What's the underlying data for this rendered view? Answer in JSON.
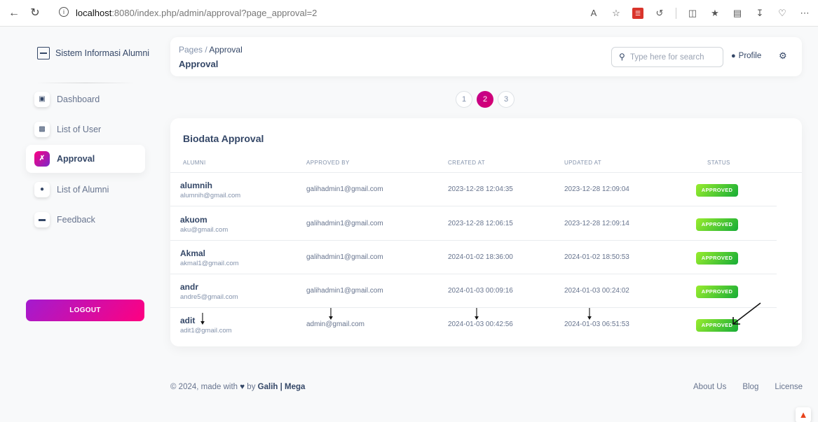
{
  "browser": {
    "url_host": "localhost",
    "url_path": ":8080/index.php/admin/approval?page_approval=2",
    "icons": [
      "back-icon",
      "reload-icon",
      "info-icon",
      "read-aloud-icon",
      "favorite-icon",
      "extension-icon",
      "split-screen-icon",
      "favorites-icon",
      "collections-icon",
      "download-icon",
      "copilot-icon",
      "more-icon"
    ]
  },
  "sidebar": {
    "brand": "Sistem Informasi Alumni",
    "items": [
      {
        "label": "Dashboard",
        "icon": "store-icon",
        "active": false
      },
      {
        "label": "List of User",
        "icon": "users-icon",
        "active": false
      },
      {
        "label": "Approval",
        "icon": "tools-icon",
        "active": true
      },
      {
        "label": "List of Alumni",
        "icon": "user-plus-icon",
        "active": false
      },
      {
        "label": "Feedback",
        "icon": "inbox-icon",
        "active": false
      }
    ],
    "logout_label": "LOGOUT"
  },
  "navbar": {
    "breadcrumb_root": "Pages",
    "breadcrumb_sep": " / ",
    "breadcrumb_current": "Approval",
    "title": "Approval",
    "search_placeholder": "Type here for search",
    "profile_label": "Profile"
  },
  "pagination": {
    "pages": [
      "1",
      "2",
      "3"
    ],
    "active": "2"
  },
  "table": {
    "title": "Biodata Approval",
    "headers": [
      "Alumni",
      "Approved By",
      "Created At",
      "Updated At",
      "Status"
    ],
    "rows": [
      {
        "name": "alumnih",
        "email": "alumnih@gmail.com",
        "approved_by": "galihadmin1@gmail.com",
        "created_at": "2023-12-28 12:04:35",
        "updated_at": "2023-12-28 12:09:04",
        "status": "APPROVED"
      },
      {
        "name": "akuom",
        "email": "aku@gmail.com",
        "approved_by": "galihadmin1@gmail.com",
        "created_at": "2023-12-28 12:06:15",
        "updated_at": "2023-12-28 12:09:14",
        "status": "APPROVED"
      },
      {
        "name": "Akmal",
        "email": "akmal1@gmail.com",
        "approved_by": "galihadmin1@gmail.com",
        "created_at": "2024-01-02 18:36:00",
        "updated_at": "2024-01-02 18:50:53",
        "status": "APPROVED"
      },
      {
        "name": "andr",
        "email": "andre5@gmail.com",
        "approved_by": "galihadmin1@gmail.com",
        "created_at": "2024-01-03 00:09:16",
        "updated_at": "2024-01-03 00:24:02",
        "status": "APPROVED"
      },
      {
        "name": "adit",
        "email": "adit1@gmail.com",
        "approved_by": "admin@gmail.com",
        "created_at": "2024-01-03 00:42:56",
        "updated_at": "2024-01-03 06:51:53",
        "status": "APPROVED"
      }
    ]
  },
  "footer": {
    "prefix": "© 2024, made with",
    "by": "by",
    "authors": "Galih | Mega",
    "links": [
      "About Us",
      "Blog",
      "License"
    ]
  },
  "colors": {
    "primary_gradient_start": "#ff0080",
    "primary_gradient_end": "#7928ca",
    "success_start": "#17ad37",
    "success_end": "#98ec2d",
    "text_dark": "#344767",
    "text_muted": "#8392ab"
  }
}
